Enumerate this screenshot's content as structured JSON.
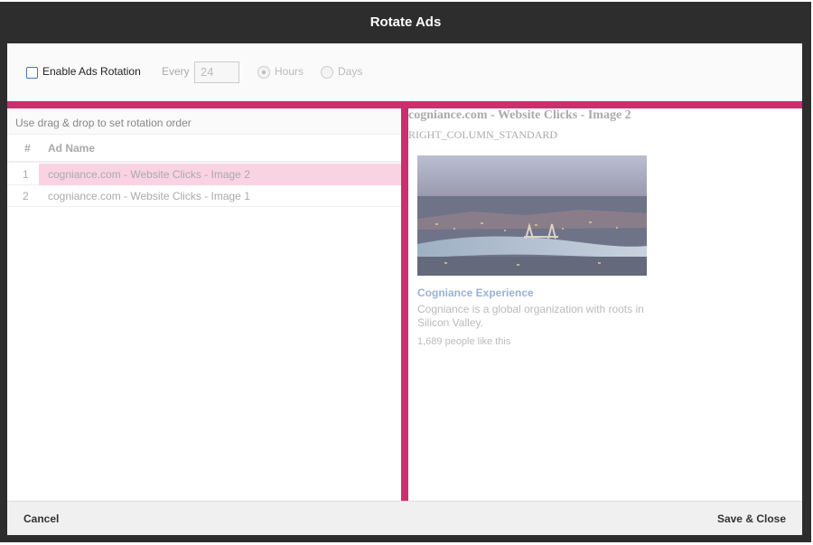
{
  "modal": {
    "title": "Rotate Ads"
  },
  "toolbar": {
    "enable_label": "Enable Ads Rotation",
    "enable_checked": false,
    "every_label": "Every",
    "every_value": "24",
    "hours_label": "Hours",
    "hours_selected": true,
    "days_label": "Days",
    "days_selected": false
  },
  "left": {
    "hint": "Use drag & drop to set rotation order",
    "columns": {
      "num": "#",
      "name": "Ad Name"
    },
    "rows": [
      {
        "num": "1",
        "name": "cogniance.com - Website Clicks - Image 2",
        "selected": true
      },
      {
        "num": "2",
        "name": "cogniance.com - Website Clicks - Image 1",
        "selected": false
      }
    ]
  },
  "preview": {
    "title": "cogniance.com - Website Clicks - Image 2",
    "placement": "RIGHT_COLUMN_STANDARD",
    "image_icon": "city-skyline-image",
    "headline": "Cogniance Experience",
    "description": "Cogniance is a global organization with roots in Silicon Valley.",
    "likes": "1,689 people like this"
  },
  "footer": {
    "cancel_label": "Cancel",
    "save_label": "Save & Close"
  },
  "colors": {
    "accent": "#c8306e",
    "header_bg": "#2d2d2d",
    "selected_row": "#fad3e3"
  }
}
